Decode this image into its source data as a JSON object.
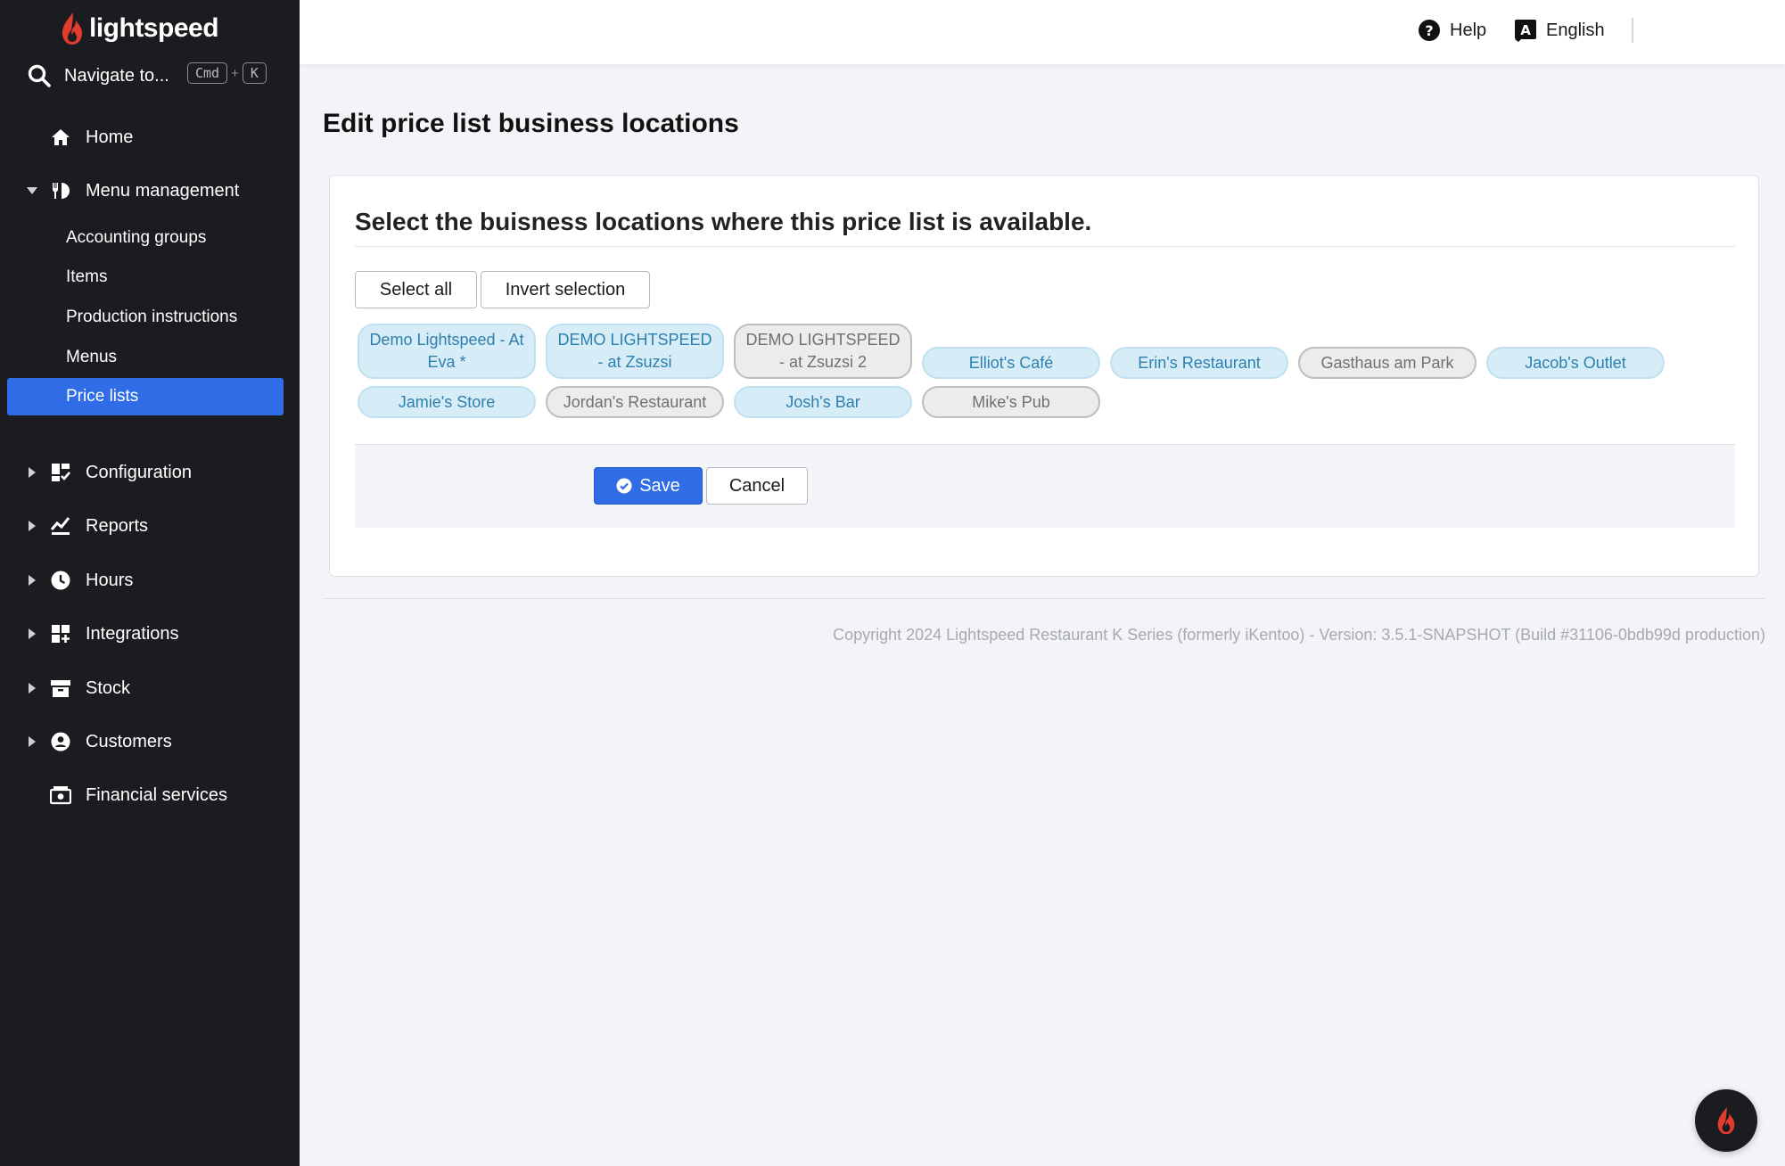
{
  "brand": {
    "name": "lightspeed",
    "accent": "#e33b2e"
  },
  "search": {
    "label": "Navigate to...",
    "key1": "Cmd",
    "plus": "+",
    "key2": "K"
  },
  "sidebar": {
    "home": "Home",
    "menu_management": "Menu management",
    "sub_items": [
      "Accounting groups",
      "Items",
      "Production instructions",
      "Menus",
      "Price lists"
    ],
    "active_sub_item": "Price lists",
    "configuration": "Configuration",
    "reports": "Reports",
    "hours": "Hours",
    "integrations": "Integrations",
    "stock": "Stock",
    "customers": "Customers",
    "financial_services": "Financial services"
  },
  "topbar": {
    "help": "Help",
    "language": "English"
  },
  "page": {
    "title": "Edit price list business locations",
    "heading": "Select the buisness locations where this price list is available.",
    "select_all": "Select all",
    "invert_selection": "Invert selection",
    "save": "Save",
    "cancel": "Cancel"
  },
  "locations": [
    {
      "name": "Demo Lightspeed - At Eva *",
      "selected": true
    },
    {
      "name": "DEMO LIGHTSPEED - at Zsuzsi",
      "selected": true
    },
    {
      "name": "DEMO LIGHTSPEED - at Zsuzsi 2",
      "selected": false
    },
    {
      "name": "Elliot's Café",
      "selected": true
    },
    {
      "name": "Erin's Restaurant",
      "selected": true
    },
    {
      "name": "Gasthaus am Park",
      "selected": false
    },
    {
      "name": "Jacob's Outlet",
      "selected": true
    },
    {
      "name": "Jamie's Store",
      "selected": true
    },
    {
      "name": "Jordan's Restaurant",
      "selected": false
    },
    {
      "name": "Josh's Bar",
      "selected": true
    },
    {
      "name": "Mike's Pub",
      "selected": false
    }
  ],
  "footer": {
    "copyright": "Copyright 2024 Lightspeed Restaurant K Series (formerly iKentoo) - Version: 3.5.1-SNAPSHOT (Build #31106-0bdb99d production)"
  }
}
